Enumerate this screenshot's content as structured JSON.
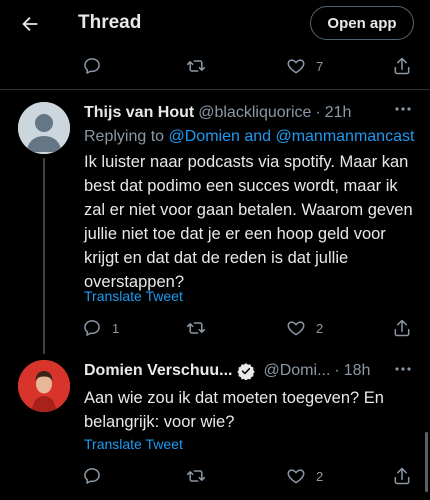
{
  "header": {
    "title": "Thread",
    "open_app_label": "Open app"
  },
  "top_actions": {
    "reply_count": "",
    "retweet_count": "",
    "like_count": "7"
  },
  "tweets": [
    {
      "display_name": "Thijs van Hout",
      "handle": "@blackliquorice",
      "separator": "·",
      "time": "21h",
      "replying_prefix": "Replying to",
      "replying_to": "@Domien and @manmanmancast",
      "text": "Ik luister naar podcasts via spotify. Maar kan best dat podimo een succes wordt, maar ik zal er niet voor gaan betalen. Waarom geven jullie niet toe dat je er een hoop geld voor krijgt en dat dat de reden is dat jullie overstappen?",
      "translate": "Translate Tweet",
      "reply_count": "1",
      "retweet_count": "",
      "like_count": "2",
      "avatar": "default-avatar"
    },
    {
      "display_name": "Domien Verschuu...",
      "verified": true,
      "handle": "@Domi...",
      "separator": "·",
      "time": "18h",
      "text": "Aan wie zou ik dat moeten toegeven? En belangrijk: voor wie?",
      "translate": "Translate Tweet",
      "reply_count": "",
      "retweet_count": "",
      "like_count": "2",
      "avatar": "profile-photo"
    }
  ],
  "colors": {
    "background": "#000000",
    "text": "#e7e9ea",
    "secondary": "#8b98a5",
    "link": "#1d9bf0",
    "divider": "#2f3336",
    "avatar_red": "#d8342c"
  }
}
